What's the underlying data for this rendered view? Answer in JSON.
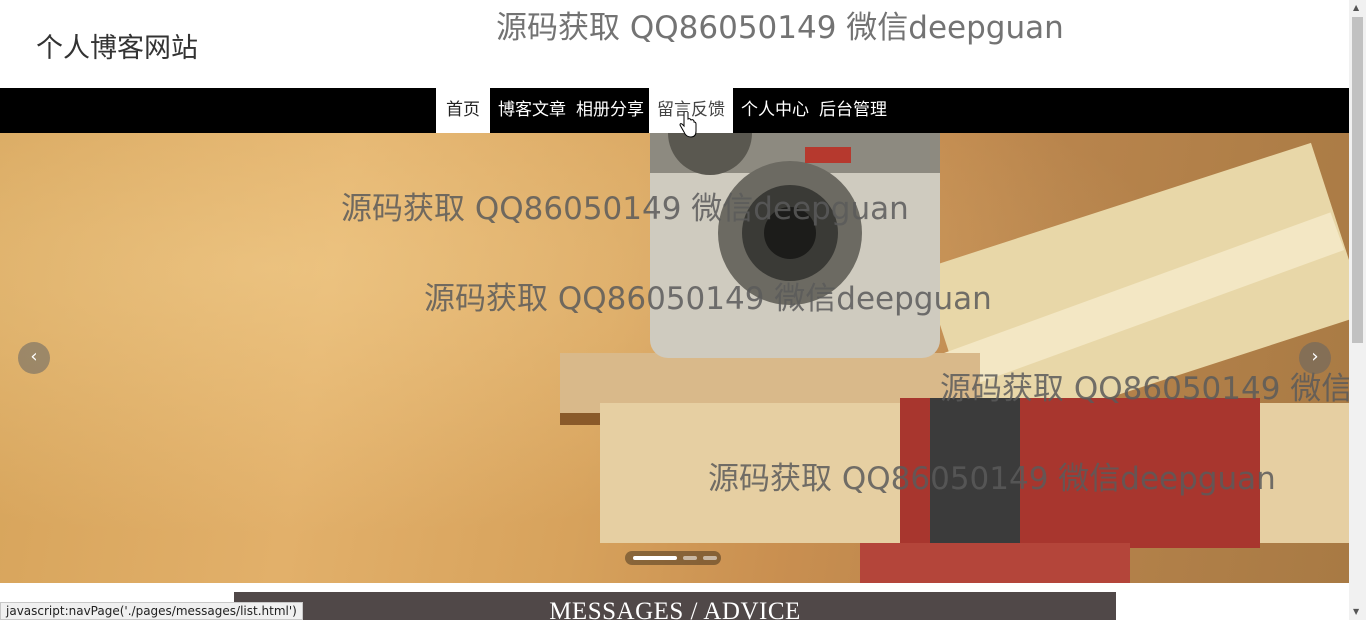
{
  "header": {
    "site_title": "个人博客网站",
    "watermark_text": "源码获取 QQ86050149 微信deepguan"
  },
  "nav": {
    "items": [
      {
        "label": "首页",
        "state": "active"
      },
      {
        "label": "博客文章",
        "state": "normal"
      },
      {
        "label": "相册分享",
        "state": "normal"
      },
      {
        "label": "留言反馈",
        "state": "hover"
      },
      {
        "label": "个人中心",
        "state": "normal"
      },
      {
        "label": "后台管理",
        "state": "normal"
      }
    ]
  },
  "banner": {
    "image": "camera-on-books",
    "prev_icon": "chevron-left-icon",
    "next_icon": "chevron-right-icon",
    "slides_total": 3,
    "active_slide": 1
  },
  "section": {
    "title": "MESSAGES / ADVICE"
  },
  "status_bar": {
    "url": "javascript:navPage('./pages/messages/list.html')"
  },
  "colors": {
    "navbar_bg": "#000000",
    "section_bar_bg": "#504848",
    "banner_wall": "#d6a35a"
  }
}
